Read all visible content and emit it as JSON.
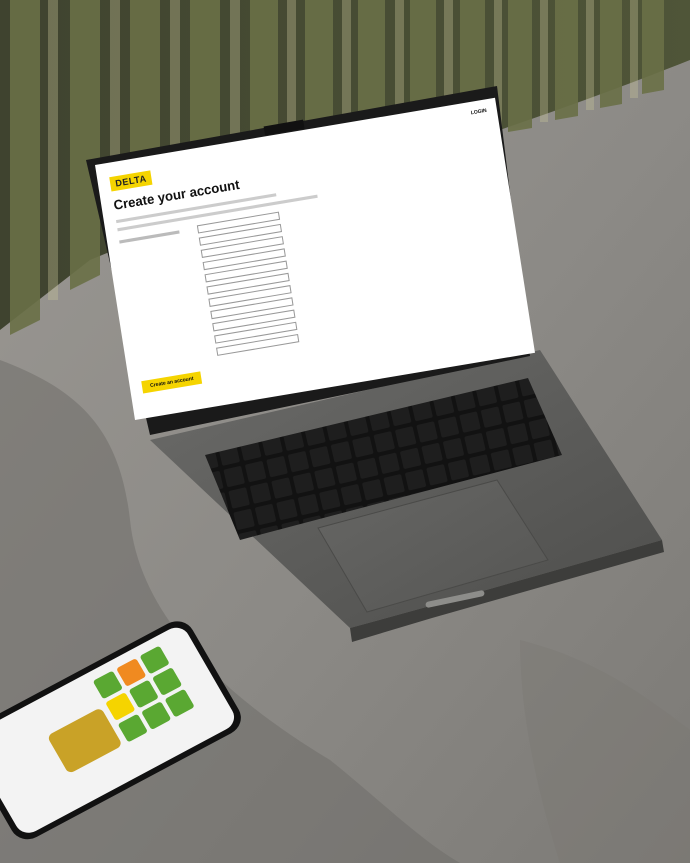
{
  "screen": {
    "brand": "DELTA",
    "login_label": "LOGIN",
    "page_title": "Create your account",
    "cta_label": "Create an account"
  },
  "colors": {
    "accent_yellow": "#f5d400",
    "app_green": "#5aa832",
    "app_orange": "#f08a20"
  }
}
